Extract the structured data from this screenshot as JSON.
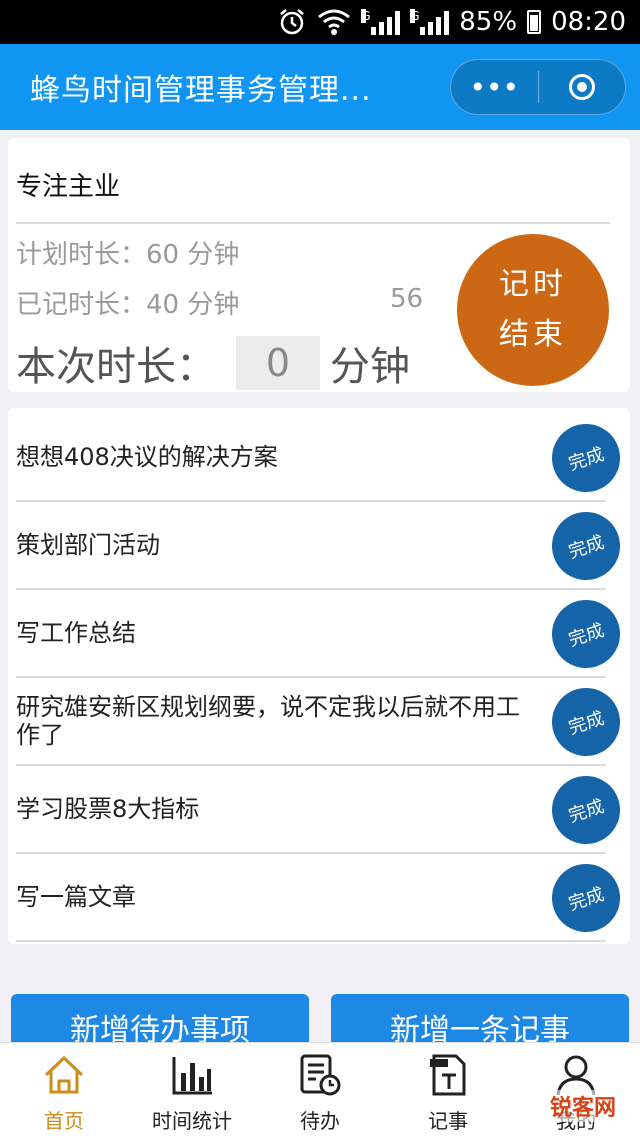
{
  "status_bar": {
    "battery": "85%",
    "time": "08:20",
    "network_label": "G"
  },
  "header": {
    "title": "蜂鸟时间管理事务管理..."
  },
  "timer": {
    "task_name": "专注主业",
    "planned": "计划时长：60 分钟",
    "recorded": "已记时长：40 分钟",
    "seconds": "56",
    "current_label": "本次时长：",
    "current_value": "0",
    "current_unit": "分钟",
    "end_button_line1": "记时",
    "end_button_line2": "结束"
  },
  "todos": [
    {
      "text": "想想408决议的解决方案",
      "action": "完成"
    },
    {
      "text": "策划部门活动",
      "action": "完成"
    },
    {
      "text": "写工作总结",
      "action": "完成"
    },
    {
      "text": "研究雄安新区规划纲要，说不定我以后就不用工作了",
      "action": "完成"
    },
    {
      "text": "学习股票8大指标",
      "action": "完成"
    },
    {
      "text": "写一篇文章",
      "action": "完成"
    }
  ],
  "buttons": {
    "add_todo": "新增待办事项",
    "add_note": "新增一条记事"
  },
  "tabs": [
    {
      "label": "首页",
      "icon": "home-icon",
      "active": true
    },
    {
      "label": "时间统计",
      "icon": "bar-chart-icon",
      "active": false
    },
    {
      "label": "待办",
      "icon": "todo-clock-icon",
      "active": false
    },
    {
      "label": "记事",
      "icon": "txt-note-icon",
      "active": false
    },
    {
      "label": "我的",
      "icon": "user-icon",
      "active": false
    }
  ],
  "watermark": "锐客网",
  "colors": {
    "header": "#1195f2",
    "end_button": "#cc6814",
    "done_button": "#1564a8",
    "tab_active": "#cc8c1a"
  }
}
